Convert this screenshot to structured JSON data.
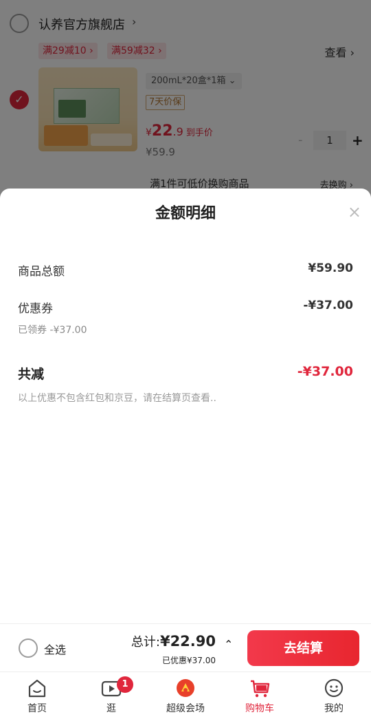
{
  "store": {
    "name": "认养官方旗舰店",
    "chevron": "›"
  },
  "promos": [
    "满29减10 ›",
    "满59减32 ›"
  ],
  "view_more": "查看 ›",
  "product": {
    "check": "✓",
    "spec": "200mL*20盒*1箱  ⌄",
    "guarantee": "7天价保",
    "price_currency": "¥",
    "price_int": "22",
    "price_dec": ".9",
    "price_label": "到手价",
    "original_price": "¥59.9",
    "quantity": "1",
    "minus": "-",
    "plus": "+"
  },
  "swap": {
    "text": "满1件可低价换购商品",
    "link": "去换购 ›"
  },
  "sheet": {
    "title": "金额明细",
    "close": "×",
    "goods_total_label": "商品总额",
    "goods_total_value": "¥59.90",
    "coupon_label": "优惠券",
    "coupon_value": "-¥37.00",
    "coupon_sub": "已领券 -¥37.00",
    "reduction_label": "共减",
    "reduction_value": "-¥37.00",
    "note": "以上优惠不包含红包和京豆，请在结算页查看.."
  },
  "checkout": {
    "select_all": "全选",
    "total_prefix": "总计:",
    "total_value": "¥22.90",
    "saved": "已优惠¥37.00",
    "chevron": "⌃",
    "pay_button": "去结算"
  },
  "tabs": [
    {
      "label": "首页",
      "icon": "home-icon"
    },
    {
      "label": "逛",
      "icon": "video-icon",
      "badge": "1"
    },
    {
      "label": "超级会场",
      "icon": "super-venue-icon"
    },
    {
      "label": "购物车",
      "icon": "cart-icon",
      "active": true
    },
    {
      "label": "我的",
      "icon": "profile-icon"
    }
  ],
  "colors": {
    "accent": "#e0263c",
    "promo_bg": "#fde4e7"
  }
}
